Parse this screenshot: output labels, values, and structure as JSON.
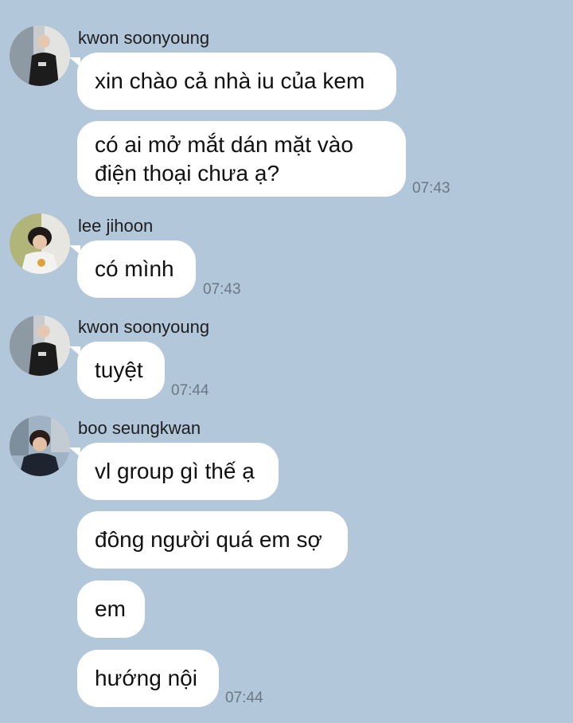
{
  "colors": {
    "background": "#b2c7da",
    "bubble": "#ffffff",
    "timestamp": "#6a7885"
  },
  "groups": [
    {
      "sender": "kwon soonyoung",
      "avatar_icon": "profile-photo-icon",
      "messages": [
        "xin chào cả nhà iu của kem",
        "có ai mở mắt dán mặt vào điện thoại chưa ạ?"
      ],
      "time": "07:43"
    },
    {
      "sender": "lee jihoon",
      "avatar_icon": "profile-photo-icon",
      "messages": [
        "có mình"
      ],
      "time": "07:43"
    },
    {
      "sender": "kwon soonyoung",
      "avatar_icon": "profile-photo-icon",
      "messages": [
        "tuyệt"
      ],
      "time": "07:44"
    },
    {
      "sender": "boo seungkwan",
      "avatar_icon": "profile-photo-icon",
      "messages": [
        "vl group gì thế ạ",
        "đông người quá em sợ",
        "em",
        "hướng nội"
      ],
      "time": "07:44"
    }
  ]
}
